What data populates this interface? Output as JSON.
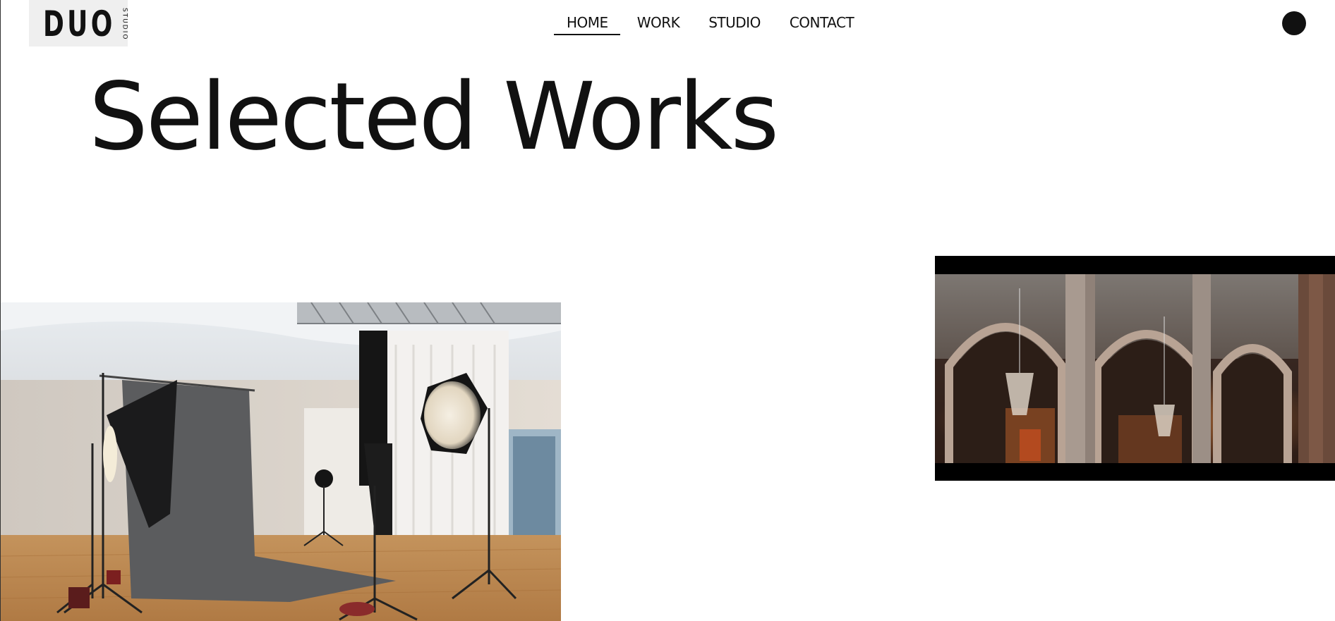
{
  "logo": {
    "main": "DUO",
    "sub": "STUDIO"
  },
  "nav": {
    "items": [
      {
        "label": "HOME",
        "active": true
      },
      {
        "label": "WORK",
        "active": false
      },
      {
        "label": "STUDIO",
        "active": false
      },
      {
        "label": "CONTACT",
        "active": false
      }
    ]
  },
  "page": {
    "title": "Selected Works"
  },
  "colors": {
    "text": "#111111",
    "background": "#ffffff",
    "logo_bg": "#efefef"
  },
  "works": [
    {
      "kind": "photo",
      "subject": "photography studio"
    },
    {
      "kind": "video",
      "subject": "cathedral interior"
    }
  ]
}
